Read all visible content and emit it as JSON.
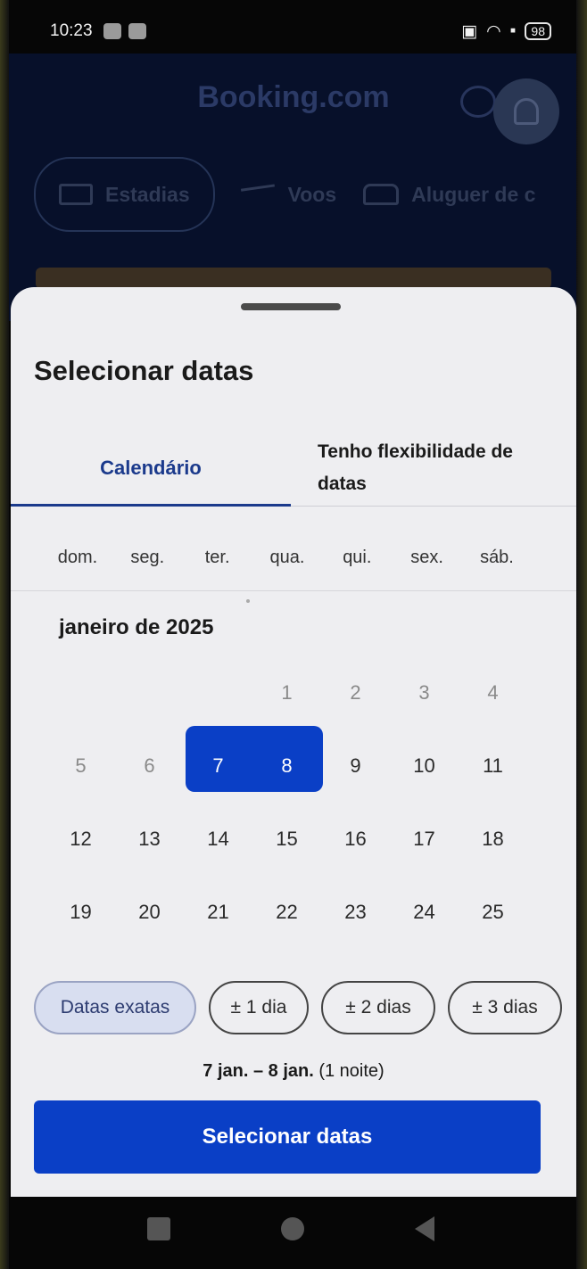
{
  "status_bar": {
    "time": "10:23",
    "battery": "98"
  },
  "app": {
    "brand": "Booking.com",
    "tabs": [
      {
        "label": "Estadias",
        "icon": "bed-icon"
      },
      {
        "label": "Voos",
        "icon": "plane-icon"
      },
      {
        "label": "Aluguer de c",
        "icon": "car-icon"
      }
    ]
  },
  "sheet": {
    "title": "Selecionar datas",
    "tab_calendar": "Calendário",
    "tab_flexible_line1": "Tenho flexibilidade de",
    "tab_flexible_line2": "datas",
    "weekdays": [
      "dom.",
      "seg.",
      "ter.",
      "qua.",
      "qui.",
      "sex.",
      "sáb."
    ],
    "month": "janeiro de 2025",
    "weeks": [
      [
        "",
        "",
        "",
        "1",
        "2",
        "3",
        "4"
      ],
      [
        "5",
        "6",
        "7",
        "8",
        "9",
        "10",
        "11"
      ],
      [
        "12",
        "13",
        "14",
        "15",
        "16",
        "17",
        "18"
      ],
      [
        "19",
        "20",
        "21",
        "22",
        "23",
        "24",
        "25"
      ]
    ],
    "flex_options": [
      "Datas exatas",
      "± 1 dia",
      "± 2 dias",
      "± 3 dias"
    ],
    "range_dates": "7 jan. – 8 jan.",
    "range_nights": "(1 noite)",
    "cta_label": "Selecionar datas"
  },
  "colors": {
    "primary": "#0a3fc6",
    "tab_active_text": "#1b3a8c",
    "sheet_bg": "#eeeef1"
  }
}
